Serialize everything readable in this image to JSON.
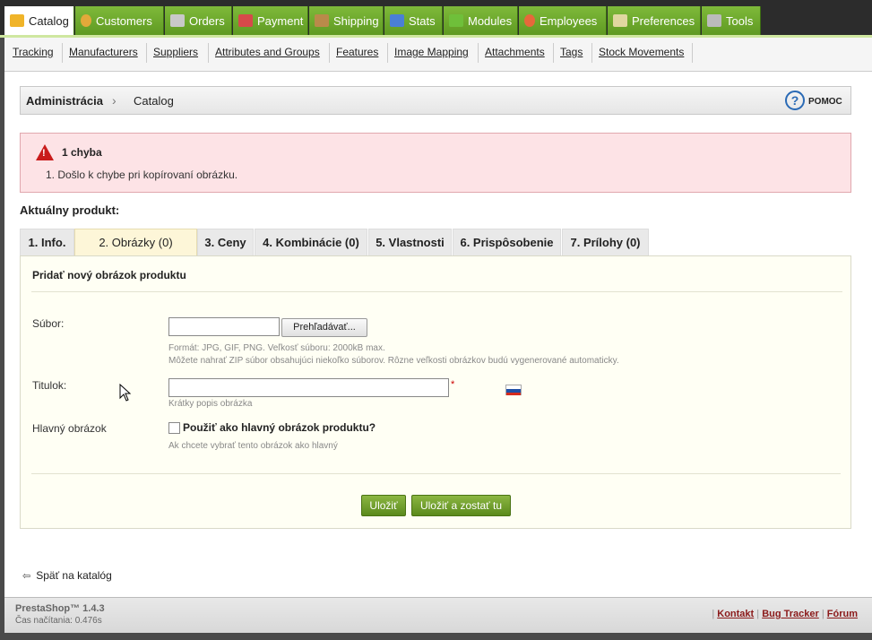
{
  "top_tabs": [
    {
      "label": "Catalog",
      "icon": "folder-icon",
      "color": "#f0b429"
    },
    {
      "label": "Customers",
      "icon": "customers-icon",
      "color": "#e2a93a"
    },
    {
      "label": "Orders",
      "icon": "cart-icon",
      "color": "#c9c9c9"
    },
    {
      "label": "Payment",
      "icon": "payment-icon",
      "color": "#d64a4a"
    },
    {
      "label": "Shipping",
      "icon": "truck-icon",
      "color": "#b98a4a"
    },
    {
      "label": "Stats",
      "icon": "stats-icon",
      "color": "#4a7fd6"
    },
    {
      "label": "Modules",
      "icon": "puzzle-icon",
      "color": "#6fbf3a"
    },
    {
      "label": "Employees",
      "icon": "employee-icon",
      "color": "#e6683b"
    },
    {
      "label": "Preferences",
      "icon": "preferences-icon",
      "color": "#e0d7a0"
    },
    {
      "label": "Tools",
      "icon": "tools-icon",
      "color": "#bbbbbb"
    }
  ],
  "sub_nav": [
    "Tracking",
    "Manufacturers",
    "Suppliers",
    "Attributes and Groups",
    "Features",
    "Image Mapping",
    "Attachments",
    "Tags",
    "Stock Movements"
  ],
  "breadcrumb": {
    "root": "Administrácia",
    "current": "Catalog",
    "help": "POMOC"
  },
  "error": {
    "title": "1 chyba",
    "items": [
      "1.   Došlo k chybe pri kopírovaní obrázku."
    ]
  },
  "current_product_label": "Aktuálny produkt:",
  "product_tabs": [
    "1. Info.",
    "2. Obrázky (0)",
    "3. Ceny",
    "4. Kombinácie (0)",
    "5. Vlastnosti",
    "6. Prispôsobenie",
    "7. Prílohy (0)"
  ],
  "active_product_tab": "2. Obrázky (0)",
  "form": {
    "heading": "Pridať nový obrázok produktu",
    "file_label": "Súbor:",
    "browse_label": "Prehľadávať...",
    "file_hint_1": "Formát: JPG, GIF, PNG. Veľkosť súboru: 2000kB max.",
    "file_hint_2": "Môžete nahrať ZIP súbor obsahujúci niekoľko súborov. Rôzne veľkosti obrázkov budú vygenerované automaticky.",
    "title_label": "Titulok:",
    "title_value": "",
    "required_mark": "*",
    "title_hint": "Krátky popis obrázka",
    "cover_label": "Hlavný obrázok",
    "cover_checkbox_label": "Použiť ako hlavný obrázok produktu?",
    "cover_checked": false,
    "cover_hint": "Ak chcete vybrať tento obrázok ako hlavný",
    "save_label": "Uložiť",
    "save_stay_label": "Uložiť a zostať tu"
  },
  "back_link": "Späť na katalóg",
  "footer": {
    "version": "PrestaShop™ 1.4.3",
    "load_time": "Čas načítania: 0.476s",
    "links": [
      "Kontakt",
      "Bug Tracker",
      "Fórum"
    ]
  }
}
